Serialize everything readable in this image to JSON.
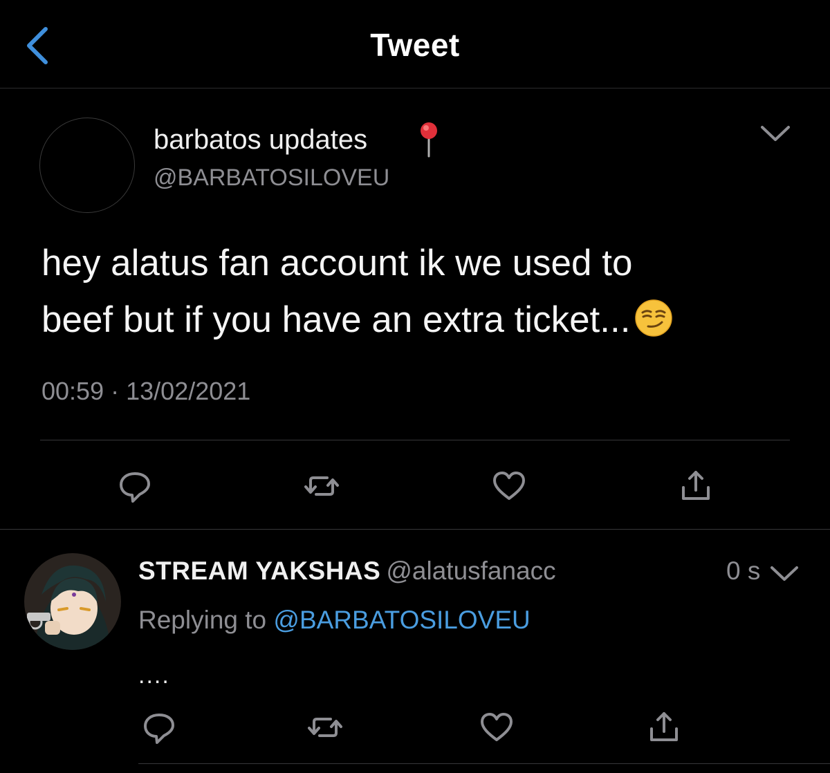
{
  "header": {
    "title": "Tweet",
    "back_icon": "chevron-left-icon"
  },
  "main_tweet": {
    "display_name": "barbatos updates",
    "name_emoji": "round-pushpin-icon",
    "handle": "@BARBATOSILOVEU",
    "text_line1": "hey alatus fan account ik we used to",
    "text_line2": "beef but if you have an extra ticket...",
    "text_emoji": "smirking-face-emoji",
    "time": "00:59",
    "separator": "·",
    "date": "13/02/2021",
    "actions": [
      "reply-icon",
      "retweet-icon",
      "like-icon",
      "share-icon"
    ]
  },
  "reply_tweet": {
    "display_name": "STREAM YAKSHAS",
    "handle": "@alatusfanacc",
    "time_ago": "0 s",
    "replying_prefix": "Replying to",
    "replying_mention": "@BARBATOSILOVEU",
    "text": "....",
    "actions": [
      "reply-icon",
      "retweet-icon",
      "like-icon",
      "share-icon"
    ]
  },
  "colors": {
    "background": "#000000",
    "accent": "#4a9de0",
    "secondary_text": "#8e8e93",
    "divider": "#38383a",
    "icon": "#8e8e93"
  }
}
